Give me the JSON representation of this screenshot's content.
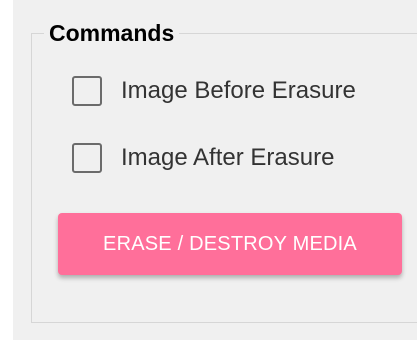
{
  "commands_group": {
    "title": "Commands",
    "options": [
      {
        "label": "Image Before Erasure",
        "checked": false
      },
      {
        "label": "Image After Erasure",
        "checked": false
      }
    ],
    "erase_button_label": "ERASE / DESTROY MEDIA"
  },
  "colors": {
    "panel_background": "#f0f0f0",
    "button_background": "#ff6f9a",
    "button_text": "#ffffff",
    "checkbox_border": "#6b6b6b"
  }
}
